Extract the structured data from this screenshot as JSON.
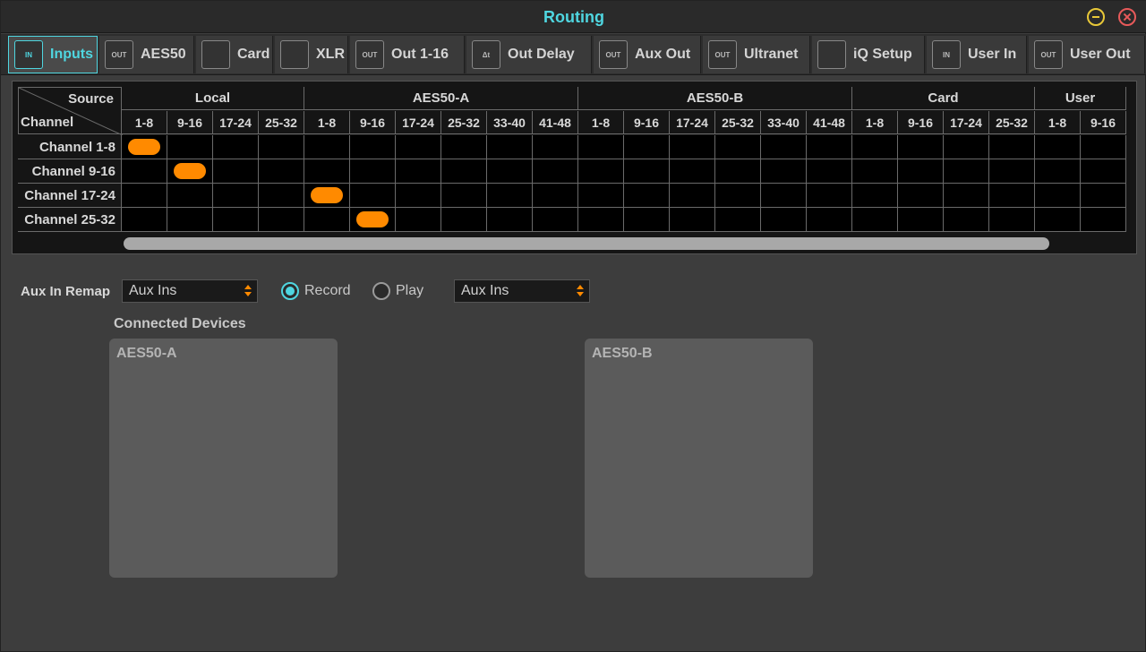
{
  "window": {
    "title": "Routing",
    "accent": "#4fd6e0",
    "minimize_icon": "minimize-icon",
    "close_icon": "close-icon"
  },
  "tabs": [
    {
      "label": "Inputs",
      "icon_text": "IN",
      "icon": "input-in-icon",
      "active": true
    },
    {
      "label": "AES50",
      "icon_text": "OUT",
      "icon": "output-out-icon",
      "active": false
    },
    {
      "label": "Card",
      "icon_text": "",
      "icon": "card-icon",
      "active": false
    },
    {
      "label": "XLR",
      "icon_text": "",
      "icon": "xlr-connector-icon",
      "active": false
    },
    {
      "label": "Out 1-16",
      "icon_text": "OUT",
      "icon": "output-out-icon",
      "active": false
    },
    {
      "label": "Out Delay",
      "icon_text": "Δt",
      "icon": "delay-icon",
      "active": false
    },
    {
      "label": "Aux Out",
      "icon_text": "OUT",
      "icon": "output-out-icon",
      "active": false
    },
    {
      "label": "Ultranet",
      "icon_text": "OUT",
      "icon": "output-out-icon",
      "active": false
    },
    {
      "label": "iQ Setup",
      "icon_text": "",
      "icon": "speaker-icon",
      "active": false
    },
    {
      "label": "User In",
      "icon_text": "IN",
      "icon": "input-in-icon",
      "active": false
    },
    {
      "label": "User Out",
      "icon_text": "OUT",
      "icon": "output-out-icon",
      "active": false
    }
  ],
  "matrix": {
    "corner_source": "Source",
    "corner_channel": "Channel",
    "groups": [
      {
        "name": "Local",
        "columns": [
          "1-8",
          "9-16",
          "17-24",
          "25-32"
        ]
      },
      {
        "name": "AES50-A",
        "columns": [
          "1-8",
          "9-16",
          "17-24",
          "25-32",
          "33-40",
          "41-48"
        ]
      },
      {
        "name": "AES50-B",
        "columns": [
          "1-8",
          "9-16",
          "17-24",
          "25-32",
          "33-40",
          "41-48"
        ]
      },
      {
        "name": "Card",
        "columns": [
          "1-8",
          "9-16",
          "17-24",
          "25-32"
        ]
      },
      {
        "name": "User",
        "columns": [
          "1-8",
          "9-16"
        ]
      }
    ],
    "rows": [
      "Channel 1-8",
      "Channel 9-16",
      "Channel 17-24",
      "Channel 25-32"
    ],
    "routes": [
      {
        "row": 0,
        "col": 0
      },
      {
        "row": 1,
        "col": 1
      },
      {
        "row": 2,
        "col": 4
      },
      {
        "row": 3,
        "col": 5
      }
    ],
    "route_color": "#ff8a00"
  },
  "aux_remap": {
    "label": "Aux In Remap",
    "select1_value": "Aux Ins",
    "radio_record": "Record",
    "radio_play": "Play",
    "selected_mode": "Record",
    "select2_value": "Aux Ins"
  },
  "connected_devices": {
    "title": "Connected Devices",
    "devices": [
      {
        "label": "AES50-A"
      },
      {
        "label": "AES50-B"
      }
    ]
  }
}
